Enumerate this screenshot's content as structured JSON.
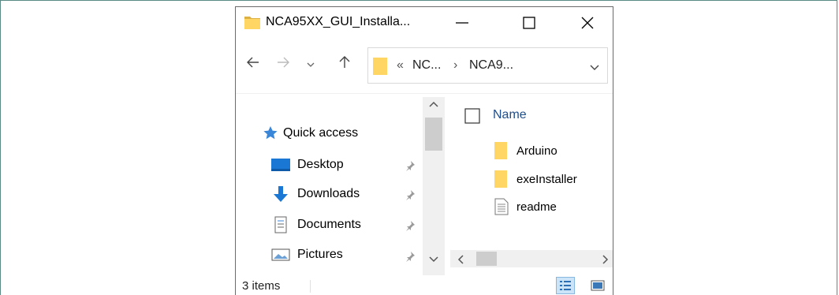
{
  "window": {
    "title": "NCA95XX_GUI_Installa...",
    "controls": {
      "minimize": "—",
      "maximize": "☐",
      "close": "✕"
    }
  },
  "address_bar": {
    "overflow_chevron": "«",
    "crumbs": [
      "NC...",
      "NCA9..."
    ],
    "separator": "›"
  },
  "nav_pane": {
    "quick_access": "Quick access",
    "items": [
      {
        "label": "Desktop",
        "icon": "desktop-icon",
        "pinned": true
      },
      {
        "label": "Downloads",
        "icon": "download-arrow-icon",
        "pinned": true
      },
      {
        "label": "Documents",
        "icon": "document-icon",
        "pinned": true
      },
      {
        "label": "Pictures",
        "icon": "picture-icon",
        "pinned": true
      }
    ]
  },
  "content": {
    "column_header": "Name",
    "files": [
      {
        "name": "Arduino",
        "type": "folder"
      },
      {
        "name": "exeInstaller",
        "type": "folder"
      },
      {
        "name": "readme",
        "type": "text-file"
      }
    ]
  },
  "status_bar": {
    "item_count": "3 items"
  },
  "colors": {
    "accent": "#0078d7",
    "folder": "#ffd564",
    "frame": "#5a8a84"
  }
}
